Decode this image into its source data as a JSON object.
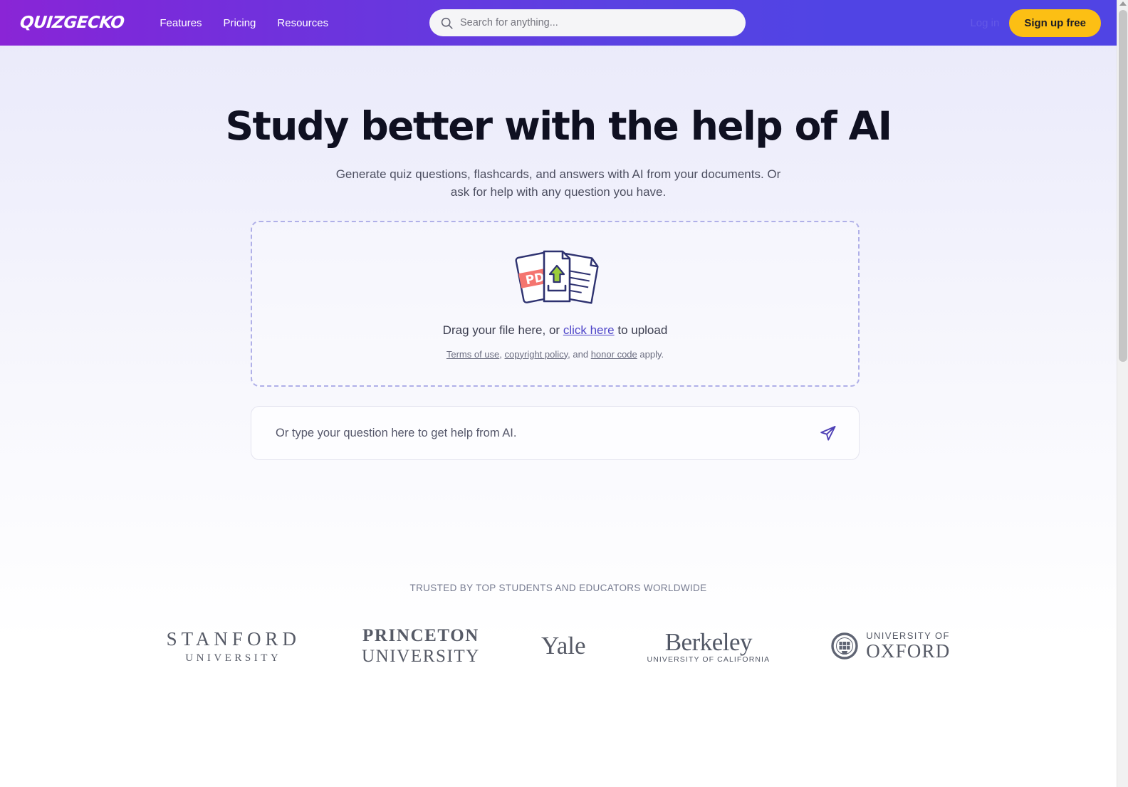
{
  "header": {
    "logo": "QUIZGECKO",
    "nav": [
      {
        "label": "Features"
      },
      {
        "label": "Pricing"
      },
      {
        "label": "Resources"
      }
    ],
    "search": {
      "placeholder": "Search for anything...",
      "value": "",
      "icon": "search-icon"
    },
    "login_label": "Log in",
    "signup_label": "Sign up free",
    "gradient_from": "#8a25d6",
    "gradient_to": "#5044e4",
    "signup_color": "#fcbf14"
  },
  "hero": {
    "title": "Study better with the help of AI",
    "subtitle": "Generate quiz questions, flashcards, and answers with AI from your documents. Or ask for help with any question you have."
  },
  "dropzone": {
    "icon": "upload-documents-icon",
    "pdf_badge": "PDF",
    "prompt_prefix": "Drag your file here, or ",
    "prompt_link": "click here",
    "prompt_suffix": " to upload",
    "legal_terms": "Terms of use",
    "legal_sep1": ", ",
    "legal_copyright": "copyright policy",
    "legal_sep2": ", and ",
    "legal_honor": "honor code",
    "legal_suffix": " apply.",
    "border_color": "#b0b0e8",
    "link_color": "#4f46c9"
  },
  "question_box": {
    "placeholder": "Or type your question here to get help from AI.",
    "value": "",
    "send_icon": "send-paper-plane-icon",
    "send_color": "#4d3fb5"
  },
  "trusted": {
    "label": "TRUSTED BY TOP STUDENTS AND EDUCATORS WORLDWIDE",
    "logos": [
      {
        "name": "stanford",
        "line1": "STANFORD",
        "line2": "UNIVERSITY"
      },
      {
        "name": "princeton",
        "line1": "PRINCETON",
        "line2": "UNIVERSITY"
      },
      {
        "name": "yale",
        "line1": "Yale",
        "line2": ""
      },
      {
        "name": "berkeley",
        "line1": "Berkeley",
        "line2": "UNIVERSITY OF CALIFORNIA"
      },
      {
        "name": "oxford",
        "line1": "UNIVERSITY OF",
        "line2": "OXFORD"
      }
    ]
  },
  "scrollbar": {
    "present": true
  }
}
